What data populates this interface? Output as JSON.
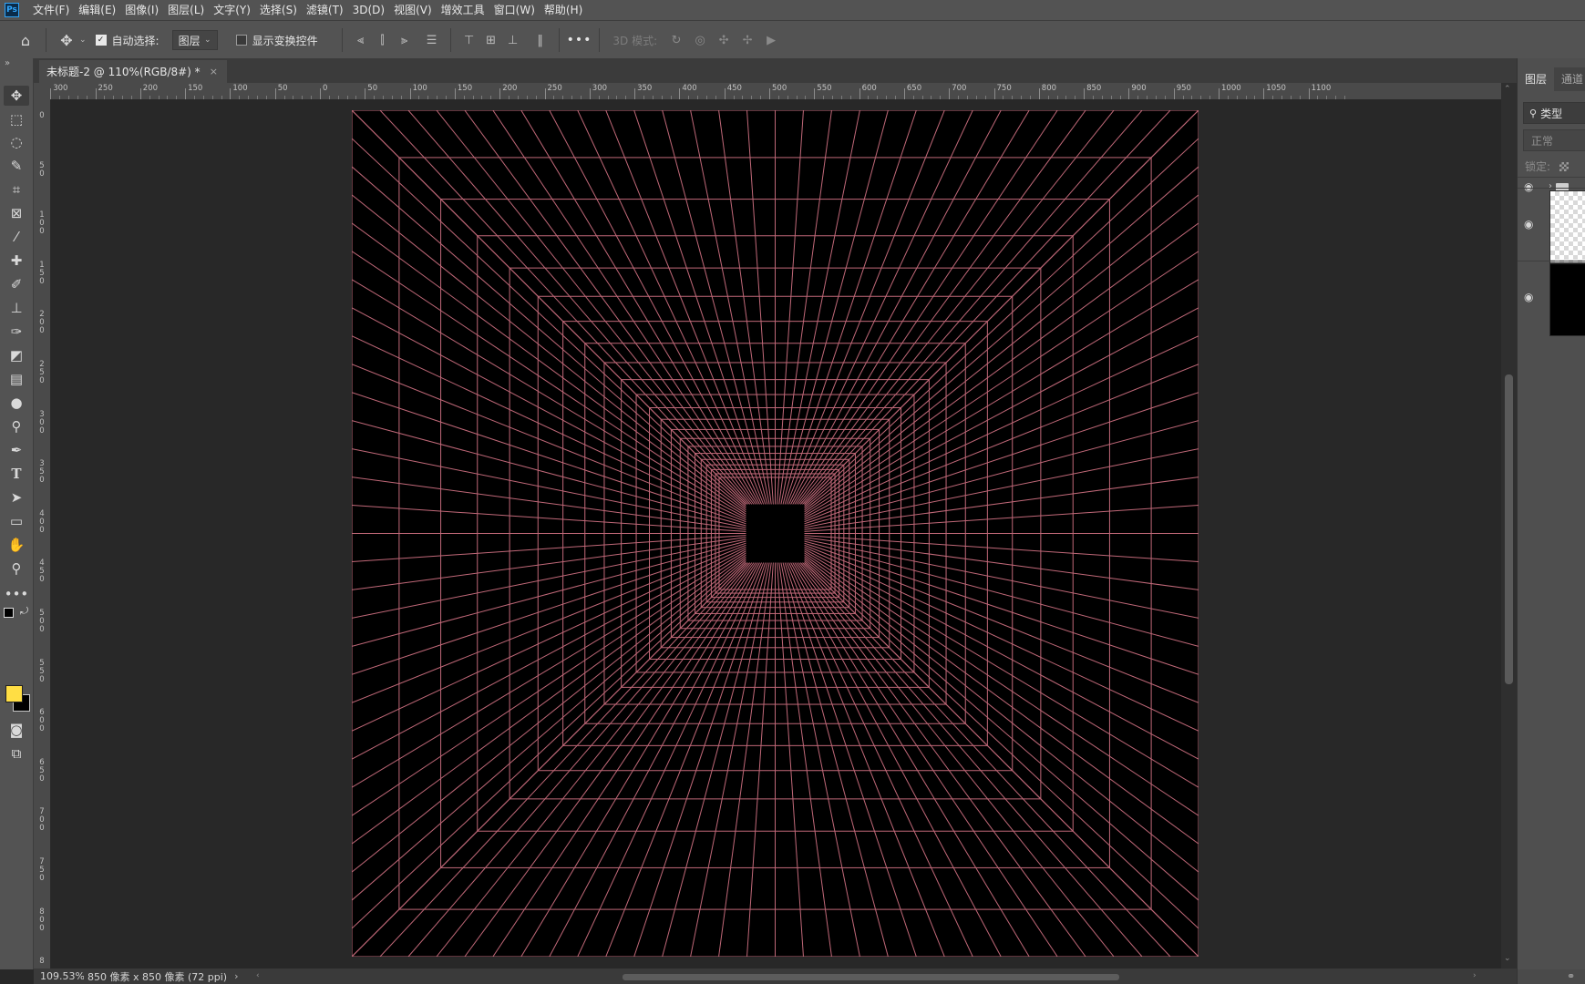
{
  "app": {
    "logo": "Ps"
  },
  "menu": [
    "文件(F)",
    "编辑(E)",
    "图像(I)",
    "图层(L)",
    "文字(Y)",
    "选择(S)",
    "滤镜(T)",
    "3D(D)",
    "视图(V)",
    "增效工具",
    "窗口(W)",
    "帮助(H)"
  ],
  "options": {
    "auto_select_label": "自动选择:",
    "auto_select_checked": true,
    "auto_select_target": "图层",
    "show_transform_label": "显示变换控件",
    "show_transform_checked": false,
    "more": "•••",
    "mode_label": "3D 模式:"
  },
  "document": {
    "tab_title": "未标题-2 @ 110%(RGB/8#) *",
    "tab_close": "×"
  },
  "ruler": {
    "horizontal_labels": [
      "300",
      "250",
      "200",
      "150",
      "100",
      "50",
      "0",
      "50",
      "100",
      "150",
      "200",
      "250",
      "300",
      "350",
      "400",
      "450",
      "500",
      "550",
      "600",
      "650",
      "700",
      "750",
      "800",
      "850",
      "900",
      "950",
      "1000",
      "1050",
      "1100"
    ],
    "vertical_labels": [
      "0",
      "5 0",
      "1 0 0",
      "1 5 0",
      "2 0 0",
      "2 5 0",
      "3 0 0",
      "3 5 0",
      "4 0 0",
      "4 5 0",
      "5 0 0",
      "5 5 0",
      "6 0 0",
      "6 5 0",
      "7 0 0",
      "7 5 0",
      "8 0 0",
      "8"
    ]
  },
  "artwork": {
    "background": "#000000",
    "line_color": "#c06878",
    "rays_per_side": 30,
    "ring_count": 22
  },
  "status": {
    "zoom": "109.53%",
    "doc_info": "850 像素 x 850 像素 (72 ppi)",
    "arrow": "›"
  },
  "layers_panel": {
    "tabs": [
      "图层",
      "通道"
    ],
    "search_placeholder": "类型",
    "blend_mode": "正常",
    "lock_label": "锁定:"
  },
  "colors": {
    "foreground": "#ffde44",
    "background": "#000000",
    "chrome": "#535353"
  }
}
